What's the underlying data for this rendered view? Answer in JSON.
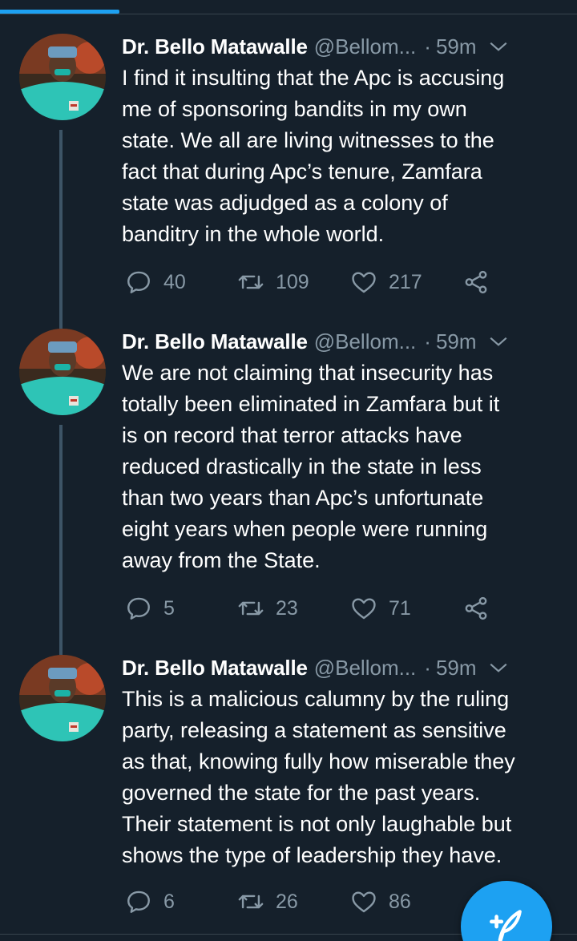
{
  "colors": {
    "background": "#15202b",
    "accent": "#1da1f2",
    "muted": "#8899a6",
    "thread_line": "#3d5466"
  },
  "tweets": [
    {
      "name": "Dr. Bello Matawalle",
      "handle": "@Bellom...",
      "dot": "·",
      "time": "59m",
      "text": "I find it insulting that the Apc is accusing\nme of sponsoring bandits in my own\nstate. We all are living witnesses to the\nfact that during Apc’s tenure, Zamfara\nstate was adjudged as a colony of\nbanditry in the whole world.",
      "replies": "40",
      "retweets": "109",
      "likes": "217",
      "icons": [
        "reply-icon",
        "retweet-icon",
        "like-icon",
        "share-icon"
      ]
    },
    {
      "name": "Dr. Bello Matawalle",
      "handle": "@Bellom...",
      "dot": "·",
      "time": "59m",
      "text": "We are not claiming that insecurity has\ntotally been eliminated in Zamfara but it\nis on record that terror attacks have\nreduced drastically in the state in less\nthan two years than Apc’s unfortunate\neight years when people were running\naway from the State.",
      "replies": "5",
      "retweets": "23",
      "likes": "71",
      "icons": [
        "reply-icon",
        "retweet-icon",
        "like-icon",
        "share-icon"
      ]
    },
    {
      "name": "Dr. Bello Matawalle",
      "handle": "@Bellom...",
      "dot": "·",
      "time": "59m",
      "text": "This is a malicious calumny by the ruling\nparty, releasing a statement as sensitive\nas that, knowing fully how miserable they\ngoverned the state for the past years.\nTheir statement is not only laughable but\nshows the type of leadership they have.",
      "replies": "6",
      "retweets": "26",
      "likes": "86",
      "icons": [
        "reply-icon",
        "retweet-icon",
        "like-icon",
        "share-icon"
      ]
    }
  ],
  "fab": {
    "icon": "compose-tweet-icon"
  }
}
